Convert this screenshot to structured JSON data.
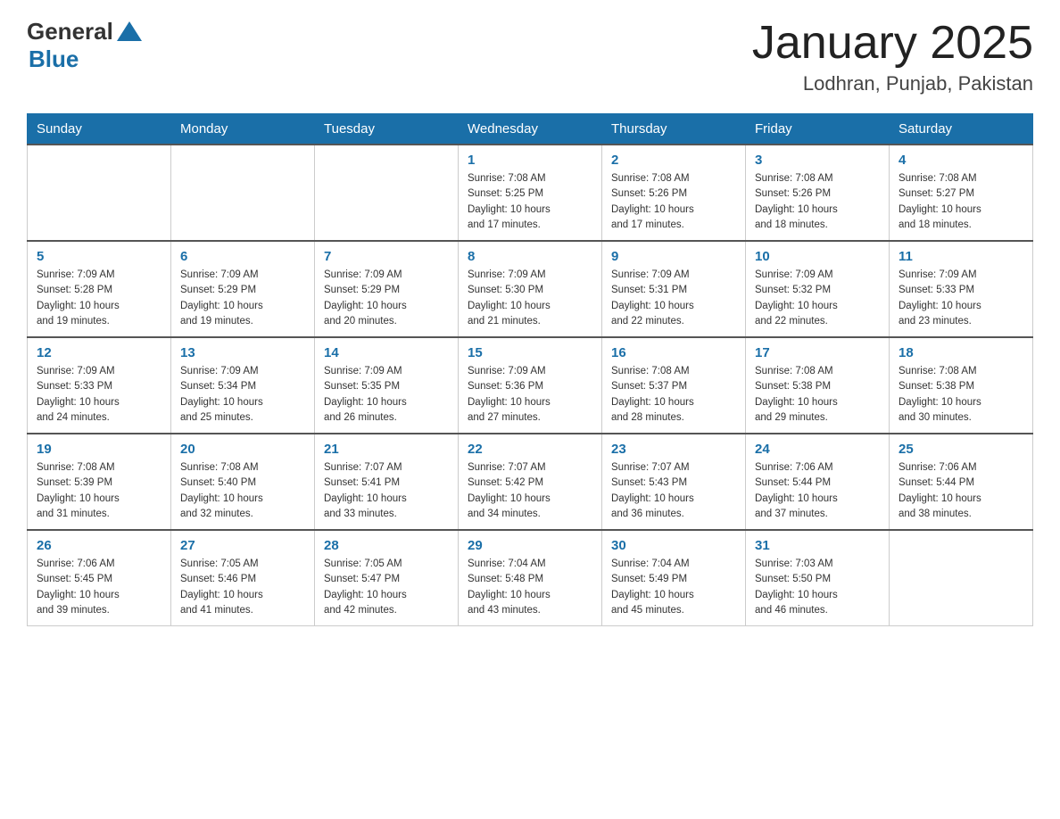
{
  "header": {
    "logo_general": "General",
    "logo_blue": "Blue",
    "month_title": "January 2025",
    "location": "Lodhran, Punjab, Pakistan"
  },
  "weekdays": [
    "Sunday",
    "Monday",
    "Tuesday",
    "Wednesday",
    "Thursday",
    "Friday",
    "Saturday"
  ],
  "weeks": [
    [
      {
        "day": "",
        "info": ""
      },
      {
        "day": "",
        "info": ""
      },
      {
        "day": "",
        "info": ""
      },
      {
        "day": "1",
        "info": "Sunrise: 7:08 AM\nSunset: 5:25 PM\nDaylight: 10 hours\nand 17 minutes."
      },
      {
        "day": "2",
        "info": "Sunrise: 7:08 AM\nSunset: 5:26 PM\nDaylight: 10 hours\nand 17 minutes."
      },
      {
        "day": "3",
        "info": "Sunrise: 7:08 AM\nSunset: 5:26 PM\nDaylight: 10 hours\nand 18 minutes."
      },
      {
        "day": "4",
        "info": "Sunrise: 7:08 AM\nSunset: 5:27 PM\nDaylight: 10 hours\nand 18 minutes."
      }
    ],
    [
      {
        "day": "5",
        "info": "Sunrise: 7:09 AM\nSunset: 5:28 PM\nDaylight: 10 hours\nand 19 minutes."
      },
      {
        "day": "6",
        "info": "Sunrise: 7:09 AM\nSunset: 5:29 PM\nDaylight: 10 hours\nand 19 minutes."
      },
      {
        "day": "7",
        "info": "Sunrise: 7:09 AM\nSunset: 5:29 PM\nDaylight: 10 hours\nand 20 minutes."
      },
      {
        "day": "8",
        "info": "Sunrise: 7:09 AM\nSunset: 5:30 PM\nDaylight: 10 hours\nand 21 minutes."
      },
      {
        "day": "9",
        "info": "Sunrise: 7:09 AM\nSunset: 5:31 PM\nDaylight: 10 hours\nand 22 minutes."
      },
      {
        "day": "10",
        "info": "Sunrise: 7:09 AM\nSunset: 5:32 PM\nDaylight: 10 hours\nand 22 minutes."
      },
      {
        "day": "11",
        "info": "Sunrise: 7:09 AM\nSunset: 5:33 PM\nDaylight: 10 hours\nand 23 minutes."
      }
    ],
    [
      {
        "day": "12",
        "info": "Sunrise: 7:09 AM\nSunset: 5:33 PM\nDaylight: 10 hours\nand 24 minutes."
      },
      {
        "day": "13",
        "info": "Sunrise: 7:09 AM\nSunset: 5:34 PM\nDaylight: 10 hours\nand 25 minutes."
      },
      {
        "day": "14",
        "info": "Sunrise: 7:09 AM\nSunset: 5:35 PM\nDaylight: 10 hours\nand 26 minutes."
      },
      {
        "day": "15",
        "info": "Sunrise: 7:09 AM\nSunset: 5:36 PM\nDaylight: 10 hours\nand 27 minutes."
      },
      {
        "day": "16",
        "info": "Sunrise: 7:08 AM\nSunset: 5:37 PM\nDaylight: 10 hours\nand 28 minutes."
      },
      {
        "day": "17",
        "info": "Sunrise: 7:08 AM\nSunset: 5:38 PM\nDaylight: 10 hours\nand 29 minutes."
      },
      {
        "day": "18",
        "info": "Sunrise: 7:08 AM\nSunset: 5:38 PM\nDaylight: 10 hours\nand 30 minutes."
      }
    ],
    [
      {
        "day": "19",
        "info": "Sunrise: 7:08 AM\nSunset: 5:39 PM\nDaylight: 10 hours\nand 31 minutes."
      },
      {
        "day": "20",
        "info": "Sunrise: 7:08 AM\nSunset: 5:40 PM\nDaylight: 10 hours\nand 32 minutes."
      },
      {
        "day": "21",
        "info": "Sunrise: 7:07 AM\nSunset: 5:41 PM\nDaylight: 10 hours\nand 33 minutes."
      },
      {
        "day": "22",
        "info": "Sunrise: 7:07 AM\nSunset: 5:42 PM\nDaylight: 10 hours\nand 34 minutes."
      },
      {
        "day": "23",
        "info": "Sunrise: 7:07 AM\nSunset: 5:43 PM\nDaylight: 10 hours\nand 36 minutes."
      },
      {
        "day": "24",
        "info": "Sunrise: 7:06 AM\nSunset: 5:44 PM\nDaylight: 10 hours\nand 37 minutes."
      },
      {
        "day": "25",
        "info": "Sunrise: 7:06 AM\nSunset: 5:44 PM\nDaylight: 10 hours\nand 38 minutes."
      }
    ],
    [
      {
        "day": "26",
        "info": "Sunrise: 7:06 AM\nSunset: 5:45 PM\nDaylight: 10 hours\nand 39 minutes."
      },
      {
        "day": "27",
        "info": "Sunrise: 7:05 AM\nSunset: 5:46 PM\nDaylight: 10 hours\nand 41 minutes."
      },
      {
        "day": "28",
        "info": "Sunrise: 7:05 AM\nSunset: 5:47 PM\nDaylight: 10 hours\nand 42 minutes."
      },
      {
        "day": "29",
        "info": "Sunrise: 7:04 AM\nSunset: 5:48 PM\nDaylight: 10 hours\nand 43 minutes."
      },
      {
        "day": "30",
        "info": "Sunrise: 7:04 AM\nSunset: 5:49 PM\nDaylight: 10 hours\nand 45 minutes."
      },
      {
        "day": "31",
        "info": "Sunrise: 7:03 AM\nSunset: 5:50 PM\nDaylight: 10 hours\nand 46 minutes."
      },
      {
        "day": "",
        "info": ""
      }
    ]
  ]
}
